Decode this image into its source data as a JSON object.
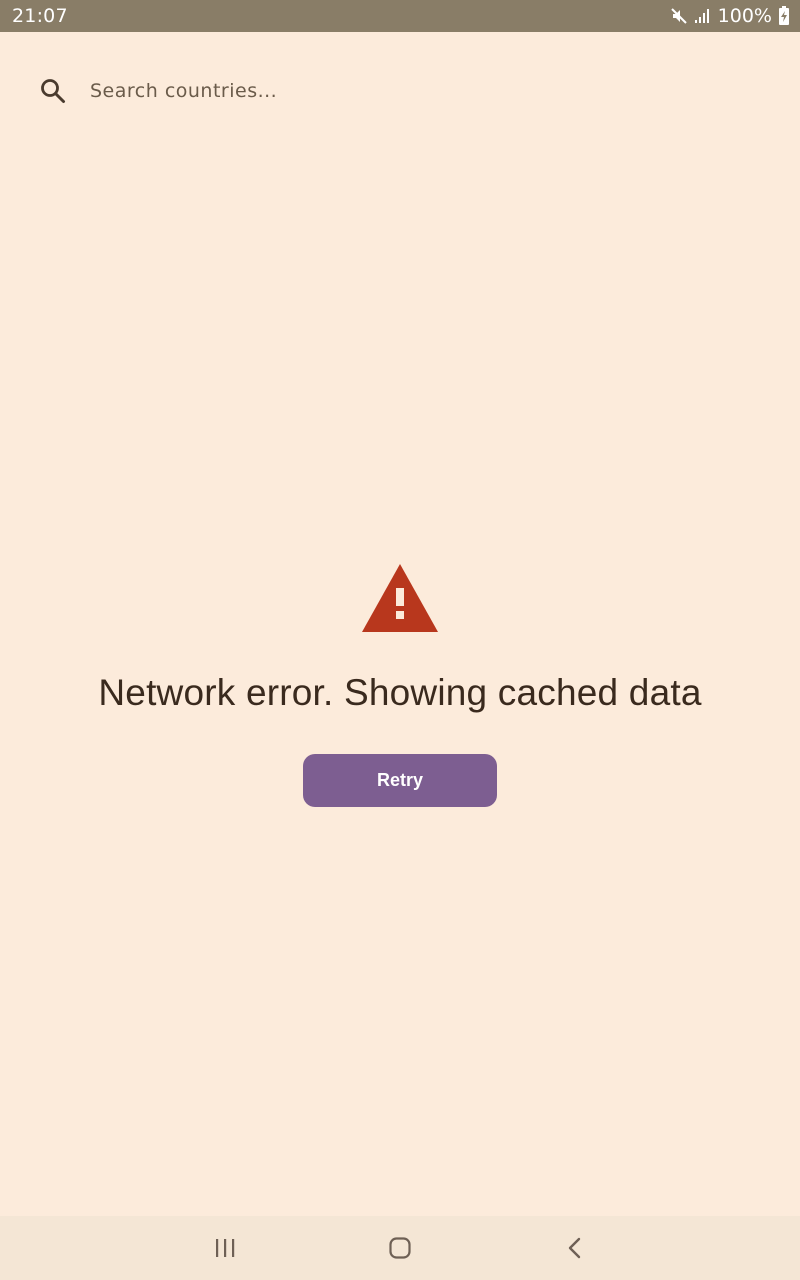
{
  "status_bar": {
    "time": "21:07",
    "battery_percent": "100%",
    "icons": [
      "mute-icon",
      "signal-icon",
      "battery-charging-icon"
    ]
  },
  "search": {
    "placeholder": "Search countries...",
    "value": "",
    "icon": "search-icon"
  },
  "error": {
    "icon": "warning-icon",
    "message": "Network error. Showing cached data",
    "retry_label": "Retry"
  },
  "nav_bar": {
    "buttons": [
      "recent-apps-icon",
      "home-icon",
      "back-icon"
    ]
  },
  "colors": {
    "background": "#fcebdb",
    "status_bar": "#897d67",
    "warning": "#b8371d",
    "button": "#7d5e91",
    "text": "#3a2a1e"
  }
}
